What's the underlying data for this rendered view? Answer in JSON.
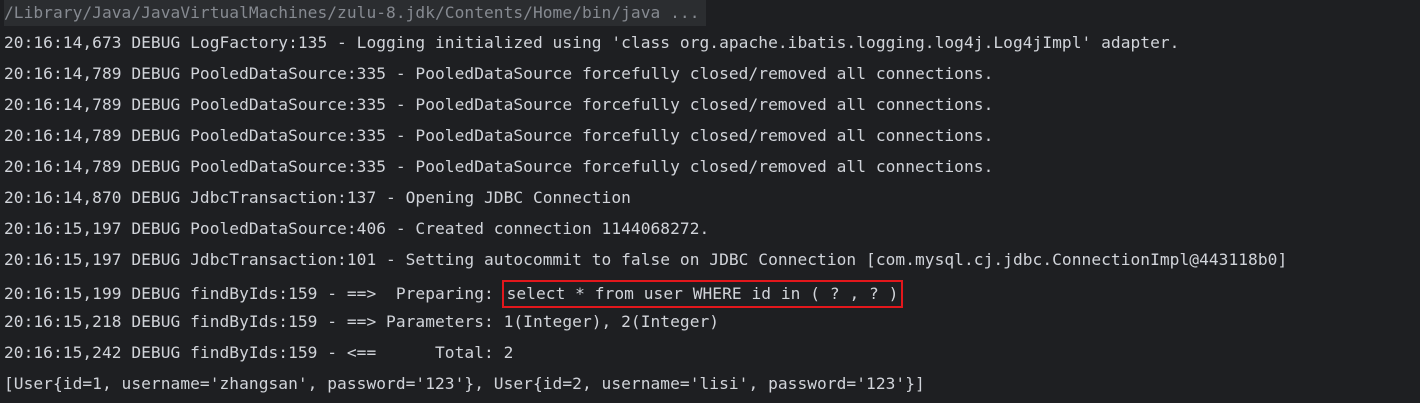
{
  "console": {
    "command": "/Library/Java/JavaVirtualMachines/zulu-8.jdk/Contents/Home/bin/java ...",
    "lines": [
      "20:16:14,673 DEBUG LogFactory:135 - Logging initialized using 'class org.apache.ibatis.logging.log4j.Log4jImpl' adapter.",
      "20:16:14,789 DEBUG PooledDataSource:335 - PooledDataSource forcefully closed/removed all connections.",
      "20:16:14,789 DEBUG PooledDataSource:335 - PooledDataSource forcefully closed/removed all connections.",
      "20:16:14,789 DEBUG PooledDataSource:335 - PooledDataSource forcefully closed/removed all connections.",
      "20:16:14,789 DEBUG PooledDataSource:335 - PooledDataSource forcefully closed/removed all connections.",
      "20:16:14,870 DEBUG JdbcTransaction:137 - Opening JDBC Connection",
      "20:16:15,197 DEBUG PooledDataSource:406 - Created connection 1144068272.",
      "20:16:15,197 DEBUG JdbcTransaction:101 - Setting autocommit to false on JDBC Connection [com.mysql.cj.jdbc.ConnectionImpl@443118b0]"
    ],
    "preparing_prefix": "20:16:15,199 DEBUG findByIds:159 - ==>  Preparing: ",
    "preparing_sql": "select * from user WHERE id in ( ? , ? )",
    "lines_after": [
      "20:16:15,218 DEBUG findByIds:159 - ==> Parameters: 1(Integer), 2(Integer)",
      "20:16:15,242 DEBUG findByIds:159 - <==      Total: 2",
      "[User{id=1, username='zhangsan', password='123'}, User{id=2, username='lisi', password='123'}]"
    ]
  }
}
